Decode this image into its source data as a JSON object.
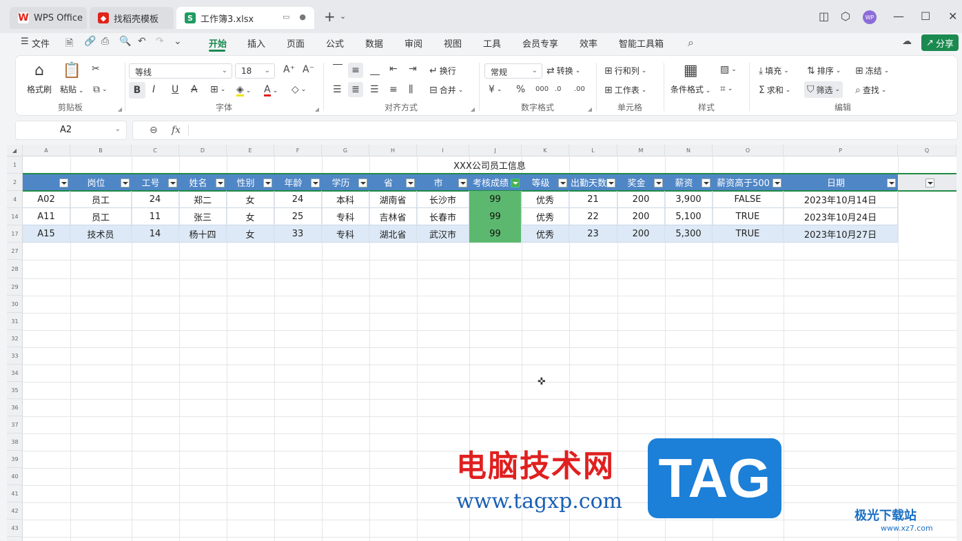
{
  "tabs": [
    {
      "label": "WPS Office"
    },
    {
      "label": "找稻壳模板"
    },
    {
      "label": "工作簿3.xlsx"
    }
  ],
  "menu": {
    "file": "文件",
    "items": [
      "开始",
      "插入",
      "页面",
      "公式",
      "数据",
      "审阅",
      "视图",
      "工具",
      "会员专享",
      "效率",
      "智能工具箱"
    ],
    "share": "分享",
    "avatar": "WP"
  },
  "ribbon": {
    "format_painter": "格式刷",
    "paste": "粘贴",
    "clipboard": "剪贴板",
    "font_name": "等线",
    "font_size": "18",
    "font_group": "字体",
    "wrap": "换行",
    "merge": "合并",
    "align_group": "对齐方式",
    "number_format": "常规",
    "convert": "转换",
    "number_group": "数字格式",
    "rows_cols": "行和列",
    "worksheet": "工作表",
    "cell_group": "单元格",
    "cond_format": "条件格式",
    "style_group": "样式",
    "fill": "填充",
    "sort": "排序",
    "freeze": "冻结",
    "sum": "求和",
    "filter": "筛选",
    "find": "查找",
    "edit_group": "编辑"
  },
  "formula_bar": {
    "cell_ref": "A2",
    "fx": "fx"
  },
  "sheet": {
    "columns": [
      "A",
      "B",
      "C",
      "D",
      "E",
      "F",
      "G",
      "H",
      "I",
      "J",
      "K",
      "L",
      "M",
      "N",
      "O",
      "P",
      "Q"
    ],
    "row_numbers": [
      "1",
      "2",
      "4",
      "14",
      "17",
      "27",
      "28",
      "29",
      "30",
      "31",
      "32",
      "33",
      "34",
      "35",
      "36",
      "37",
      "38",
      "39",
      "40",
      "41",
      "42",
      "43"
    ],
    "title": "XXX公司员工信息",
    "headers": [
      "",
      "岗位",
      "工号",
      "姓名",
      "性别",
      "年龄",
      "学历",
      "省",
      "市",
      "考核成绩",
      "等级",
      "出勤天数",
      "奖金",
      "薪资",
      "薪资高于500",
      "日期"
    ],
    "rows": [
      [
        "A02",
        "员工",
        "24",
        "郑二",
        "女",
        "24",
        "本科",
        "湖南省",
        "长沙市",
        "99",
        "优秀",
        "21",
        "200",
        "3,900",
        "FALSE",
        "2023年10月14日"
      ],
      [
        "A11",
        "员工",
        "11",
        "张三",
        "女",
        "25",
        "专科",
        "吉林省",
        "长春市",
        "99",
        "优秀",
        "22",
        "200",
        "5,100",
        "TRUE",
        "2023年10月24日"
      ],
      [
        "A15",
        "技术员",
        "14",
        "杨十四",
        "女",
        "33",
        "专科",
        "湖北省",
        "武汉市",
        "99",
        "优秀",
        "23",
        "200",
        "5,300",
        "TRUE",
        "2023年10月27日"
      ]
    ]
  },
  "watermark": {
    "brand": "电脑技术网",
    "url": "www.tagxp.com",
    "tag": "TAG",
    "site": "极光下载站",
    "site_url": "www.xz7.com"
  }
}
